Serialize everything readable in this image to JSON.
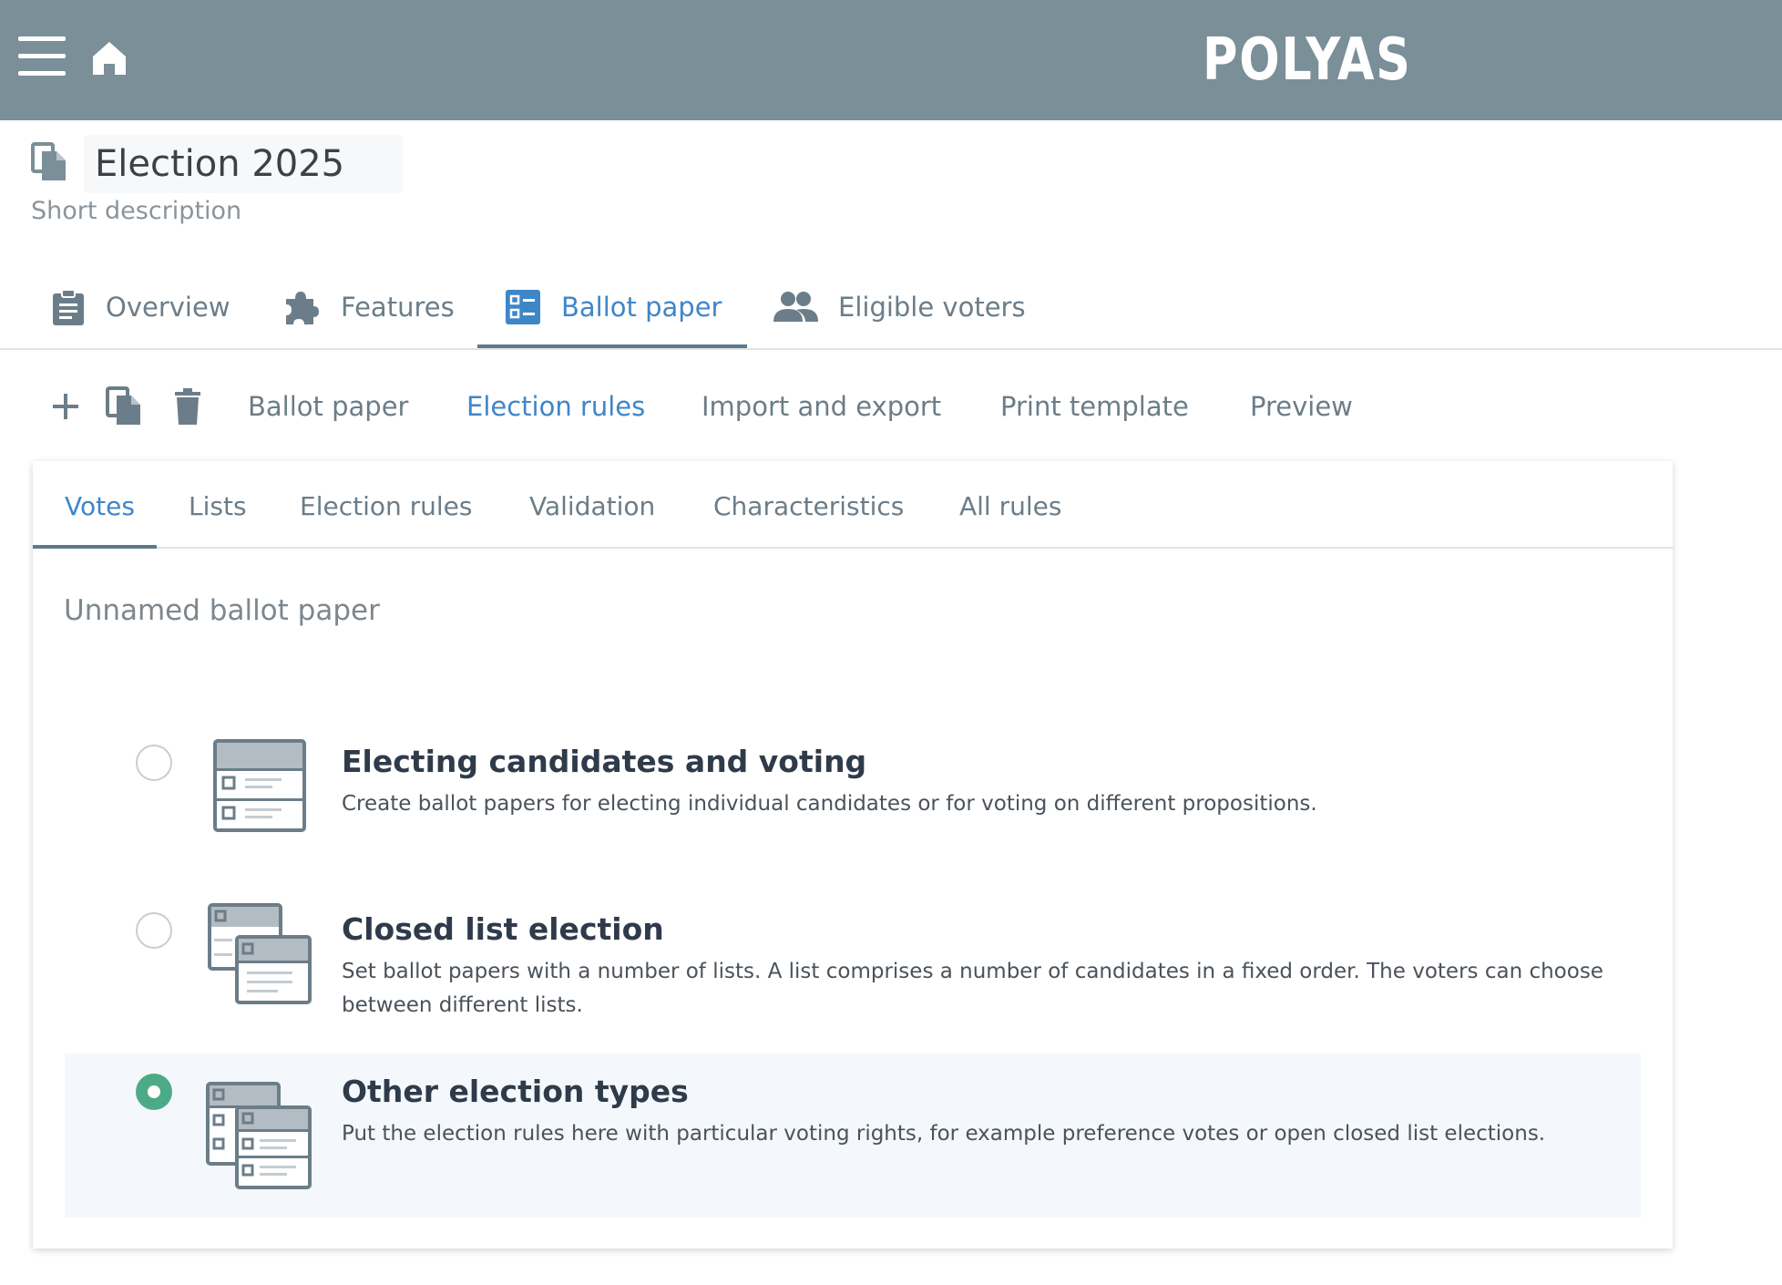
{
  "header": {
    "brand": "POLYAS",
    "menu_icon": "hamburger-menu-icon",
    "home_icon": "home-icon"
  },
  "election": {
    "title": "Election 2025",
    "description": "Short description"
  },
  "main_tabs": [
    {
      "label": "Overview",
      "icon": "clipboard-icon"
    },
    {
      "label": "Features",
      "icon": "puzzle-icon"
    },
    {
      "label": "Ballot paper",
      "icon": "ballot-list-icon"
    },
    {
      "label": "Eligible voters",
      "icon": "people-icon"
    }
  ],
  "toolbar": {
    "icons": [
      "add-icon",
      "copy-icon",
      "delete-icon"
    ],
    "items": [
      {
        "label": "Ballot paper"
      },
      {
        "label": "Election rules"
      },
      {
        "label": "Import and export"
      },
      {
        "label": "Print template"
      },
      {
        "label": "Preview"
      }
    ]
  },
  "card": {
    "tabs": [
      {
        "label": "Votes"
      },
      {
        "label": "Lists"
      },
      {
        "label": "Election rules"
      },
      {
        "label": "Validation"
      },
      {
        "label": "Characteristics"
      },
      {
        "label": "All rules"
      }
    ],
    "ballot_name": "Unnamed ballot paper",
    "options": [
      {
        "title": "Electing candidates and voting",
        "description": "Create ballot papers for electing individual candidates or for voting on different propositions."
      },
      {
        "title": "Closed list election",
        "description": "Set ballot papers with a number of lists. A list comprises a number of candidates in a fixed order. The voters can choose between different lists."
      },
      {
        "title": "Other election types",
        "description": "Put the election rules here with particular voting rights, for example preference votes or open closed list elections."
      }
    ]
  },
  "colors": {
    "header_bg": "#7a8f98",
    "accent": "#3f86c9",
    "tab_indicator": "#5b7a8c",
    "radio_selected": "#4daa86",
    "selected_row_bg": "#f4f8fd"
  }
}
